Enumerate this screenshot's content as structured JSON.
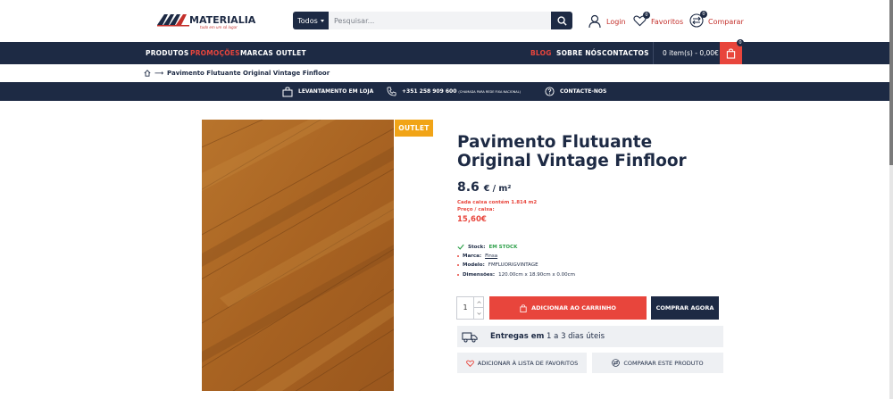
{
  "header": {
    "logo_text": "MATERIALIA",
    "logo_tagline": "tudo em um só lugar",
    "search_category": "Todos",
    "search_placeholder": "Pesquisar...",
    "login_label": "Login",
    "favorites_label": "Favoritos",
    "favorites_count": "0",
    "compare_label": "Comparar",
    "compare_count": "0"
  },
  "nav": {
    "items": [
      "PRODUTOS",
      "PROMOÇÕES",
      "MARCAS",
      "OUTLET"
    ],
    "right_items": [
      "BLOG",
      "SOBRE NÓS",
      "CONTACTOS"
    ],
    "cart_summary": "0 item(s) - 0,00€",
    "cart_count": "0"
  },
  "breadcrumb": {
    "arrow": "⟶",
    "current": "Pavimento Flutuante Original Vintage Finfloor"
  },
  "infobar": {
    "pickup": "LEVANTAMENTO EM LOJA",
    "phone": "+351 258 909 600",
    "phone_note": "(CHAMADA PARA REDE FIXA NACIONAL)",
    "contact": "CONTACTE-NOS"
  },
  "product": {
    "badge": "OUTLET",
    "title": "Pavimento Flutuante Original Vintage Finfloor",
    "price": "8.6",
    "price_unit": "€ / m²",
    "box_content": "Cada caixa contém 1.814 m2",
    "box_price_label": "Preço / caixa:",
    "box_price": "15,60€",
    "stock_label": "Stock:",
    "stock_value": "EM STOCK",
    "brand_label": "Marca:",
    "brand_value": "Finsa",
    "model_label": "Modelo:",
    "model_value": "FMFLUORIGVINTAGE",
    "dims_label": "Dimensões:",
    "dims_value": "120.00cm x 18.90cm x 0.00cm",
    "quantity": "1",
    "add_to_cart": "ADICIONAR AO CARRINHO",
    "buy_now": "COMPRAR AGORA",
    "delivery_bold": "Entregas em",
    "delivery_rest": "1 a 3 dias úteis",
    "wishlist": "ADICIONAR À LISTA DE FAVORITOS",
    "compare": "COMPARAR ESTE PRODUTO"
  },
  "colors": {
    "navy": "#1d2a44",
    "accent_red": "#e8453c",
    "outlet_orange": "#f1a417",
    "stock_green": "#2ea04a"
  }
}
